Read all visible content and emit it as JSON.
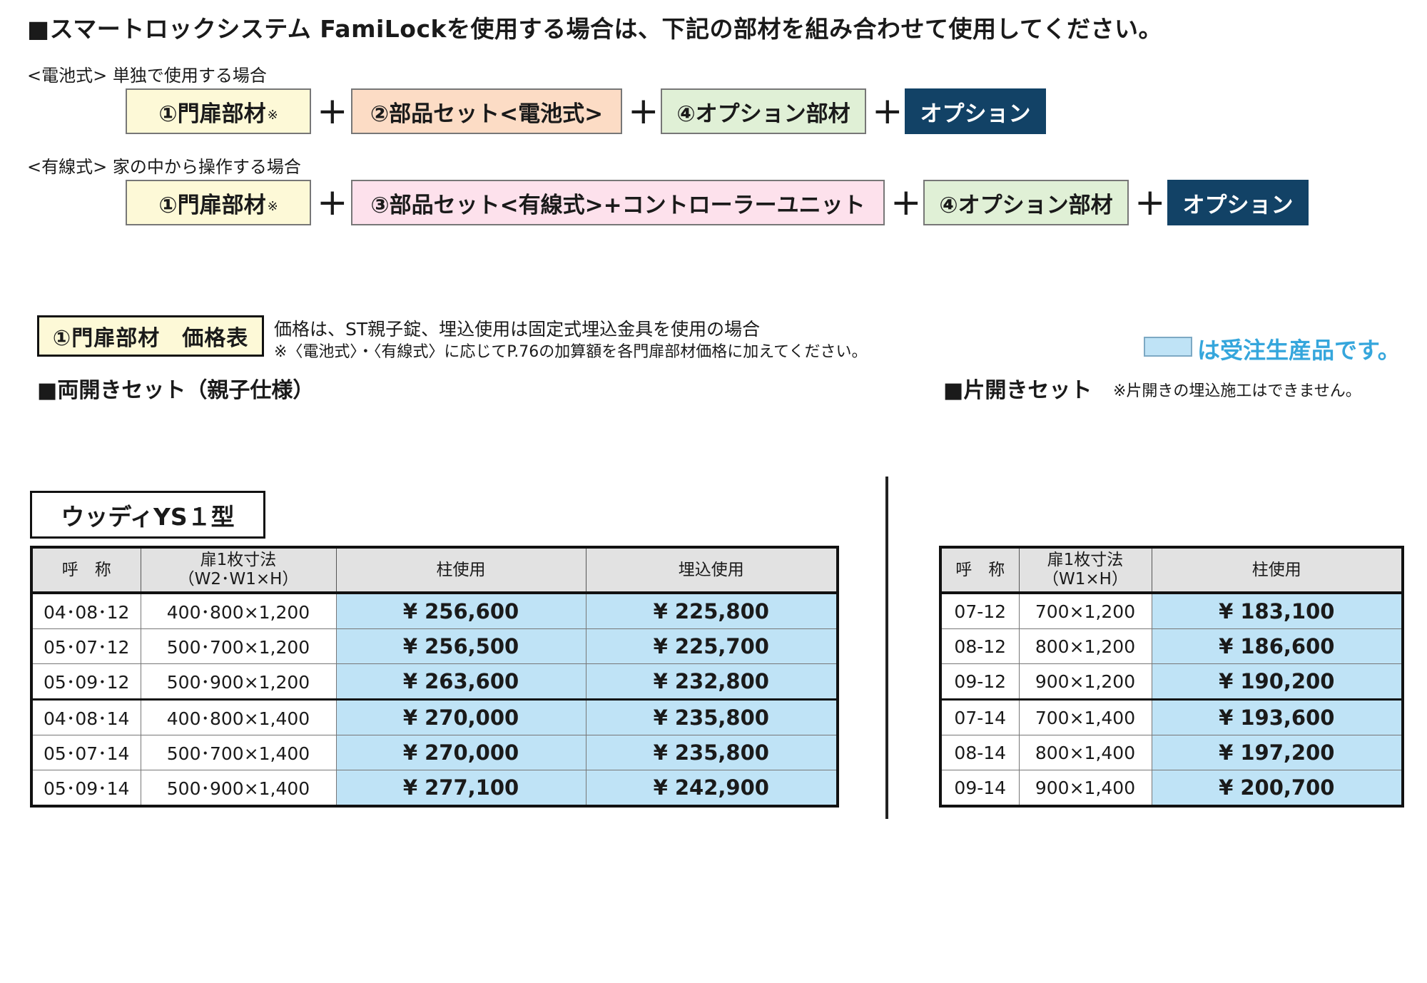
{
  "headline": "■スマートロックシステム FamiLockを使用する場合は、下記の部材を組み合わせて使用してください。",
  "battery": {
    "label": "<電池式> 単独で使用する場合",
    "box1": "①門扉部材",
    "box1_mark": "※",
    "box2": "②部品セット<電池式>",
    "box3": "④オプション部材",
    "box4": "オプション"
  },
  "wired": {
    "label": "<有線式> 家の中から操作する場合",
    "box1": "①門扉部材",
    "box1_mark": "※",
    "box2": "③部品セット<有線式>+コントローラーユニット",
    "box3": "④オプション部材",
    "box4": "オプション"
  },
  "plus": "+",
  "price_section": {
    "title": "①門扉部材　価格表",
    "note1": "価格は、ST親子錠、埋込使用は固定式埋込金具を使用の場合",
    "note2": "※〈電池式〉・〈有線式〉に応じてP.76の加算額を各門扉部材価格に加えてください。",
    "legend": "は受注生産品です。",
    "legend_color": "#bfe3f6"
  },
  "double_section": "■両開きセット（親子仕様）",
  "single_section": "■片開きセット",
  "single_note": "※片開きの埋込施工はできません。",
  "model": "ウッディYS１型",
  "double_table": {
    "headers": [
      "呼　称",
      "扉1枚寸法",
      "（W2･W1×H）",
      "柱使用",
      "埋込使用"
    ],
    "rows": [
      [
        "04･08･12",
        "400･800×1,200",
        "¥ 256,600",
        "¥ 225,800"
      ],
      [
        "05･07･12",
        "500･700×1,200",
        "¥ 256,500",
        "¥ 225,700"
      ],
      [
        "05･09･12",
        "500･900×1,200",
        "¥ 263,600",
        "¥ 232,800"
      ],
      [
        "04･08･14",
        "400･800×1,400",
        "¥ 270,000",
        "¥ 235,800"
      ],
      [
        "05･07･14",
        "500･700×1,400",
        "¥ 270,000",
        "¥ 235,800"
      ],
      [
        "05･09･14",
        "500･900×1,400",
        "¥ 277,100",
        "¥ 242,900"
      ]
    ]
  },
  "single_table": {
    "headers": [
      "呼　称",
      "扉1枚寸法",
      "（W1×H）",
      "柱使用"
    ],
    "rows": [
      [
        "07-12",
        "700×1,200",
        "¥ 183,100"
      ],
      [
        "08-12",
        "800×1,200",
        "¥ 186,600"
      ],
      [
        "09-12",
        "900×1,200",
        "¥ 190,200"
      ],
      [
        "07-14",
        "700×1,400",
        "¥ 193,600"
      ],
      [
        "08-14",
        "800×1,400",
        "¥ 197,200"
      ],
      [
        "09-14",
        "900×1,400",
        "¥ 200,700"
      ]
    ]
  }
}
